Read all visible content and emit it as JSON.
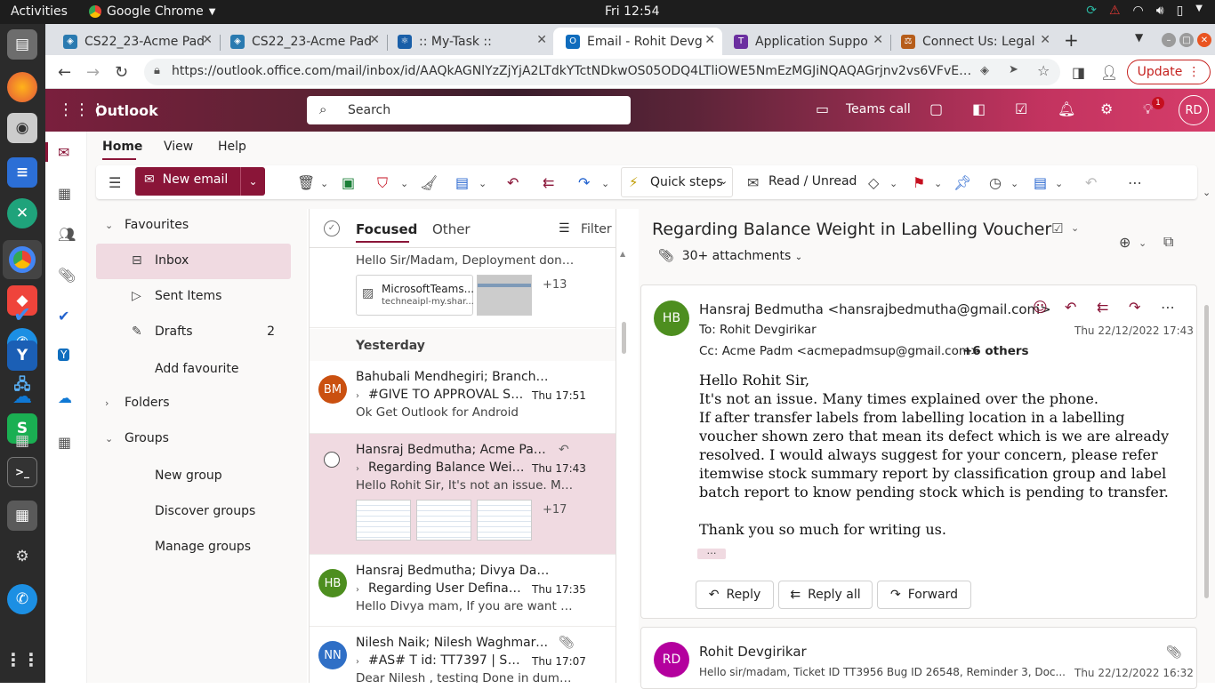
{
  "system": {
    "activities": "Activities",
    "app": "Google Chrome",
    "clock": "Fri 12:54"
  },
  "tabs": [
    {
      "title": "CS22_23-Acme Pad",
      "color": "#2a7ab0"
    },
    {
      "title": "CS22_23-Acme Pad",
      "color": "#2a7ab0"
    },
    {
      "title": ":: My-Task ::",
      "color": "#1a5fa8"
    },
    {
      "title": "Email - Rohit Devg",
      "color": "#0f6cbd"
    },
    {
      "title": "Application Suppo",
      "color": "#6b2fa0"
    },
    {
      "title": "Connect Us: Legal",
      "color": "#b65d1a"
    }
  ],
  "browser": {
    "url": "https://outlook.office.com/mail/inbox/id/AAQkAGNlYzZjYjA2LTdkYTctNDkwOS05ODQ4LTliOWE5NmEzMGJiNQAQAGrjnv2vs6VFvE2Xejk9in...",
    "update": "Update"
  },
  "outlook": {
    "title": "Outlook",
    "search_placeholder": "Search",
    "teams": "Teams call",
    "avatar": "RD",
    "notif_count": "1"
  },
  "ribbon": {
    "tabs": [
      "Home",
      "View",
      "Help"
    ],
    "new_email": "New email",
    "quick_steps": "Quick steps",
    "read_unread": "Read / Unread"
  },
  "folders": {
    "favourites": "Favourites",
    "inbox": "Inbox",
    "sent": "Sent Items",
    "drafts": "Drafts",
    "drafts_count": "2",
    "add_fav": "Add favourite",
    "folders": "Folders",
    "groups": "Groups",
    "new_group": "New group",
    "discover_groups": "Discover groups",
    "manage_groups": "Manage groups"
  },
  "list": {
    "focused": "Focused",
    "other": "Other",
    "filter": "Filter",
    "yesterday": "Yesterday",
    "first_preview": "Hello Sir/Madam, Deployment done b...",
    "first_attach_name": "MicrosoftTeams...",
    "first_attach_src": "techneaipl-my.shar...",
    "first_plus": "+13",
    "messages": [
      {
        "initials": "BM",
        "color": "#ca5010",
        "from": "Bahubali Mendhegiri; Branch Account 1",
        "subject": "#GIVE TO APPROVAL SA...",
        "time": "Thu 17:51",
        "preview": "Ok Get Outlook for Android"
      },
      {
        "initials": "",
        "color": "",
        "from": "Hansraj Bedmutha; Acme Padm; ...",
        "subject": "Regarding Balance Weig...",
        "time": "Thu 17:43",
        "preview": "Hello Rohit Sir, It's not an issue. Many t...",
        "plus": "+17"
      },
      {
        "initials": "HB",
        "color": "#4d8e1f",
        "from": "Hansraj Bedmutha; Divya Danpelli",
        "subject": "Regarding User Definabl...",
        "time": "Thu 17:35",
        "preview": "Hello Divya mam, If you are want statu..."
      },
      {
        "initials": "NN",
        "color": "#2f6fc6",
        "from": "Nilesh Naik; Nilesh Waghmare; D...",
        "subject": "#AS# T id: TT7397 | SAN...",
        "time": "Thu 17:07",
        "preview": "Dear Nilesh , testing Done in dummy : ..."
      }
    ]
  },
  "reading": {
    "title": "Regarding Balance Weight in Labelling Voucher",
    "attachments": "30+ attachments",
    "sender_initials": "HB",
    "sender": "Hansraj Bedmutha <hansrajbedmutha@gmail.com>",
    "to": "To:  Rohit Devgirikar",
    "cc": "Cc:  Acme Padm <acmepadmsup@gmail.com>",
    "others": "+6 others",
    "date": "Thu 22/12/2022 17:43",
    "body": [
      "Hello Rohit Sir,",
      "It's not an issue. Many times explained over the phone.",
      "If after transfer labels from labelling location  in a labelling voucher shown zero that mean its defect which is we are already resolved. I would always suggest for your concern, please refer itemwise stock summary report by classification group and label batch report to know pending stock which is pending to transfer.",
      "",
      "Thank you so much for writing us."
    ],
    "reply": "Reply",
    "reply_all": "Reply all",
    "forward": "Forward",
    "second": {
      "initials": "RD",
      "sender": "Rohit Devgirikar",
      "preview": "Hello sir/madam, Ticket ID TT3956 Bug ID 26548, Reminder 3, Doc...",
      "date": "Thu 22/12/2022 16:32"
    }
  }
}
